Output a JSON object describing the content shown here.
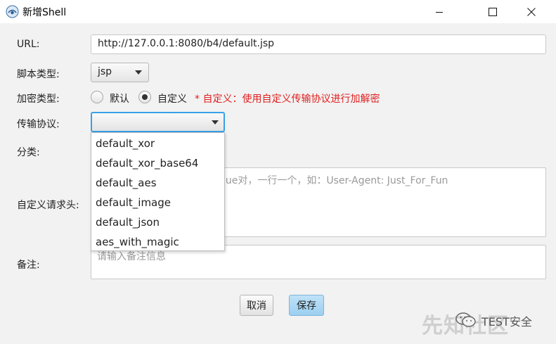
{
  "window": {
    "title": "新增Shell",
    "icon": "shell-manager-icon"
  },
  "form": {
    "url_label": "URL:",
    "url_value": "http://127.0.0.1:8080/b4/default.jsp",
    "script_type_label": "脚本类型:",
    "script_type_value": "jsp",
    "encrypt_type_label": "加密类型:",
    "encrypt_options": [
      {
        "label": "默认",
        "selected": false
      },
      {
        "label": "自定义",
        "selected": true
      }
    ],
    "encrypt_hint": "* 自定义：使用自定义传输协议进行加解密",
    "protocol_label": "传输协议:",
    "protocol_value": "",
    "category_label": "分类:",
    "headers_label": "自定义请求头:",
    "headers_placeholder_visible": "lue对，一行一个，如：User-Agent: Just_For_Fun",
    "remark_label": "备注:",
    "remark_placeholder": "请输入备注信息"
  },
  "dropdown": {
    "items": [
      "default_xor",
      "default_xor_base64",
      "default_aes",
      "default_image",
      "default_json",
      "aes_with_magic"
    ]
  },
  "buttons": {
    "cancel": "取消",
    "save": "保存"
  },
  "watermark": {
    "text": "TEST安全",
    "logo": "先知社区"
  },
  "colors": {
    "hint_red": "#e02020",
    "focus_blue": "#39a0e6",
    "save_button": "#9ccff0"
  }
}
